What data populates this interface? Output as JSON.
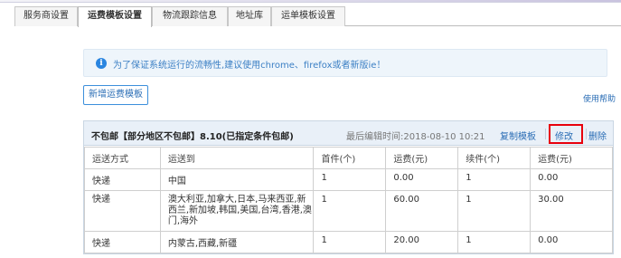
{
  "tabs": [
    {
      "label": "服务商设置"
    },
    {
      "label": "运费模板设置"
    },
    {
      "label": "物流跟踪信息"
    },
    {
      "label": "地址库"
    },
    {
      "label": "运单模板设置"
    }
  ],
  "notice": {
    "icon": "info-icon",
    "text": "为了保证系统运行的流畅性,建议使用chrome、firefox或者新版ie！"
  },
  "add_button": "新增运费模板",
  "help_link": "使用帮助",
  "template": {
    "title": "不包邮【部分地区不包邮】8.10(已指定条件包邮)",
    "last_edit": "最后编辑时间:2018-08-10 10:21",
    "actions": {
      "copy": "复制模板",
      "edit": "修改",
      "delete": "删除"
    },
    "highlight_color": "#e8000c",
    "columns": [
      "运送方式",
      "运送到",
      "首件(个)",
      "运费(元)",
      "续件(个)",
      "运费(元)"
    ],
    "rows": [
      {
        "method": "快递",
        "dest": "中国",
        "first": "1",
        "fee": "0.00",
        "add": "1",
        "add_fee": "0.00"
      },
      {
        "method": "快递",
        "dest": "澳大利亚,加拿大,日本,马来西亚,新西兰,新加坡,韩国,美国,台湾,香港,澳门,海外",
        "first": "1",
        "fee": "60.00",
        "add": "1",
        "add_fee": "30.00"
      },
      {
        "method": "快递",
        "dest": "内蒙古,西藏,新疆",
        "first": "1",
        "fee": "20.00",
        "add": "1",
        "add_fee": "0.00"
      }
    ]
  }
}
